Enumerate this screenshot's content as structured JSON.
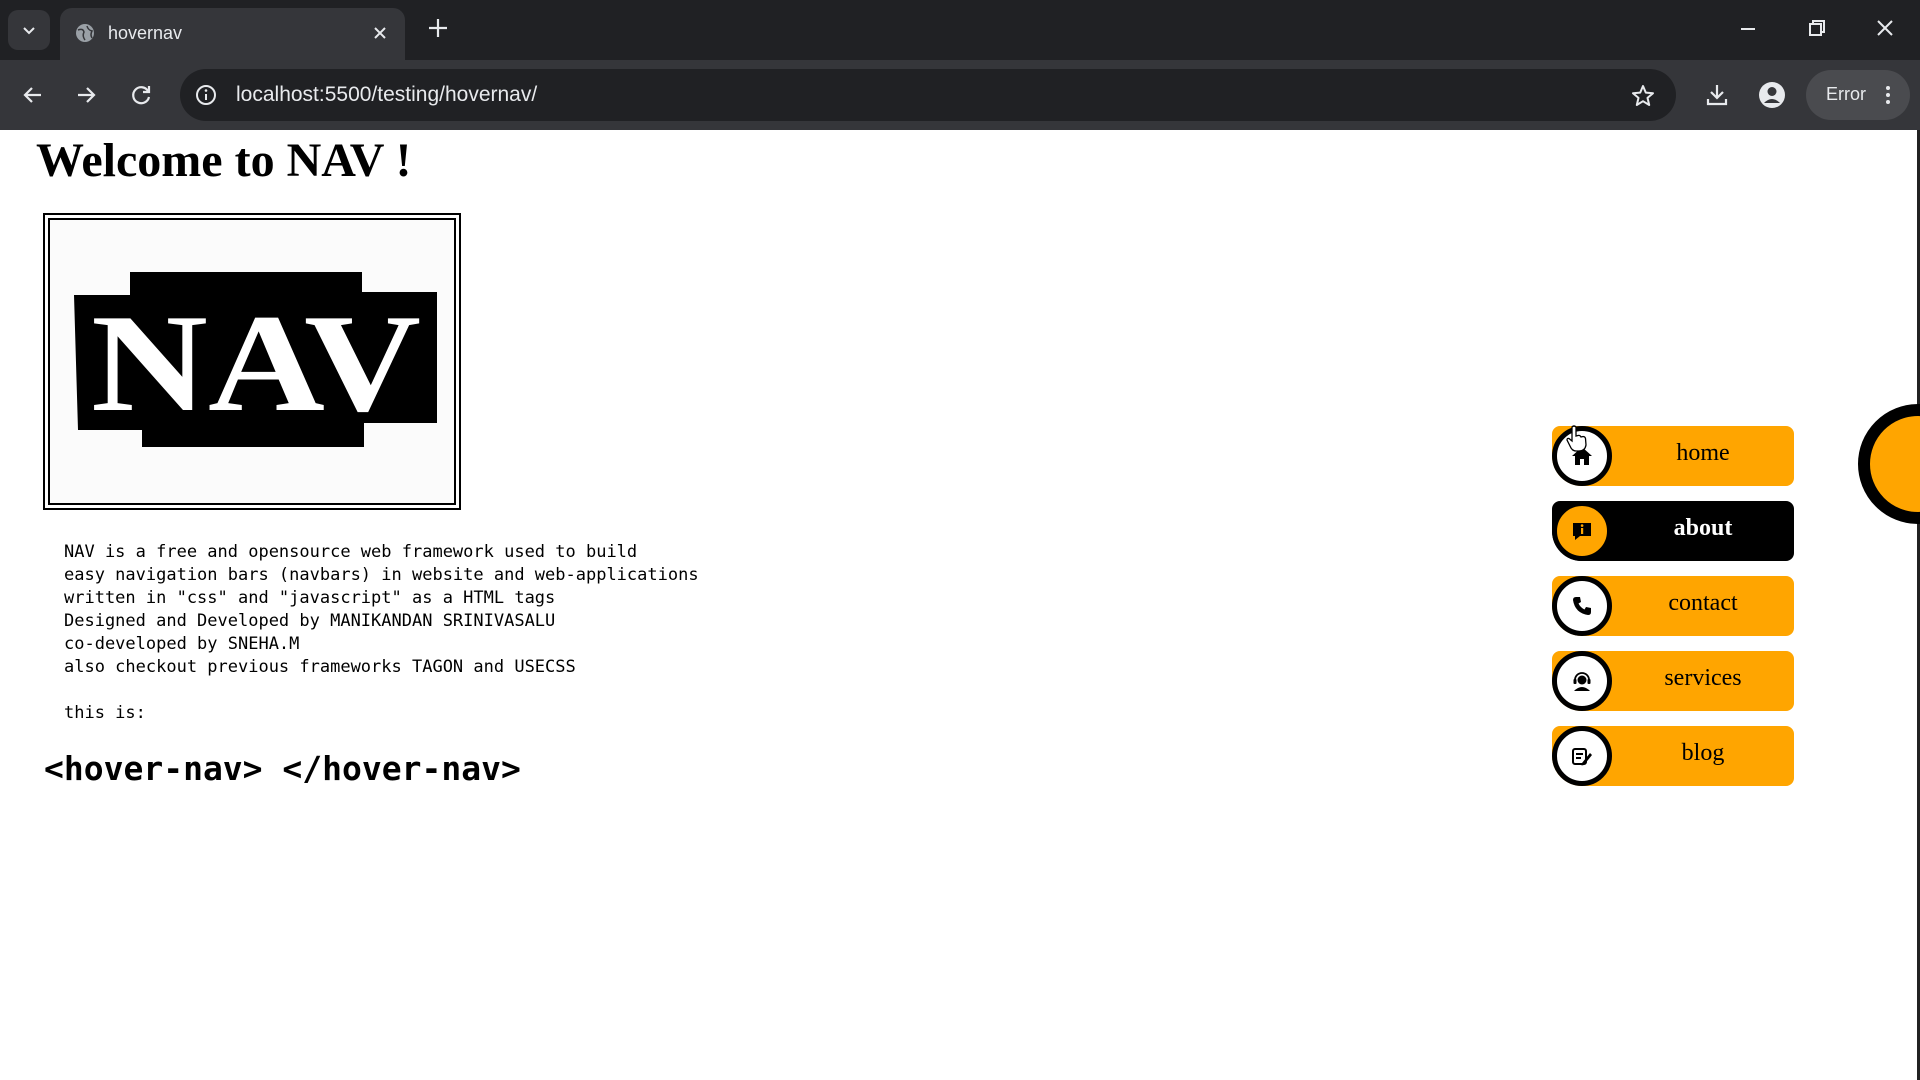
{
  "browser": {
    "tab_title": "hovernav",
    "url": "localhost:5500/testing/hovernav/",
    "profile_status": "Error"
  },
  "page": {
    "heading": "Welcome to NAV !",
    "logo_text": "NAV",
    "description_lines": [
      "NAV is a free and opensource web framework used to build",
      "easy navigation bars (navbars) in website and web-applications",
      "written in \"css\" and \"javascript\" as a HTML tags",
      "Designed and Developed by MANIKANDAN SRINIVASALU",
      "co-developed by SNEHA.M",
      "also checkout previous frameworks TAGON and USECSS",
      "",
      "this is:"
    ],
    "tag_example": "<hover-nav> </hover-nav>"
  },
  "nav": {
    "items": [
      {
        "label": "home",
        "icon": "home-icon",
        "active": false
      },
      {
        "label": "about",
        "icon": "info-icon",
        "active": true
      },
      {
        "label": "contact",
        "icon": "phone-icon",
        "active": false
      },
      {
        "label": "services",
        "icon": "support-agent-icon",
        "active": false
      },
      {
        "label": "blog",
        "icon": "edit-note-icon",
        "active": false
      }
    ]
  },
  "colors": {
    "accent": "#ffa500",
    "active_bg": "#000000",
    "chrome_dark": "#202124",
    "chrome_toolbar": "#35363a"
  }
}
